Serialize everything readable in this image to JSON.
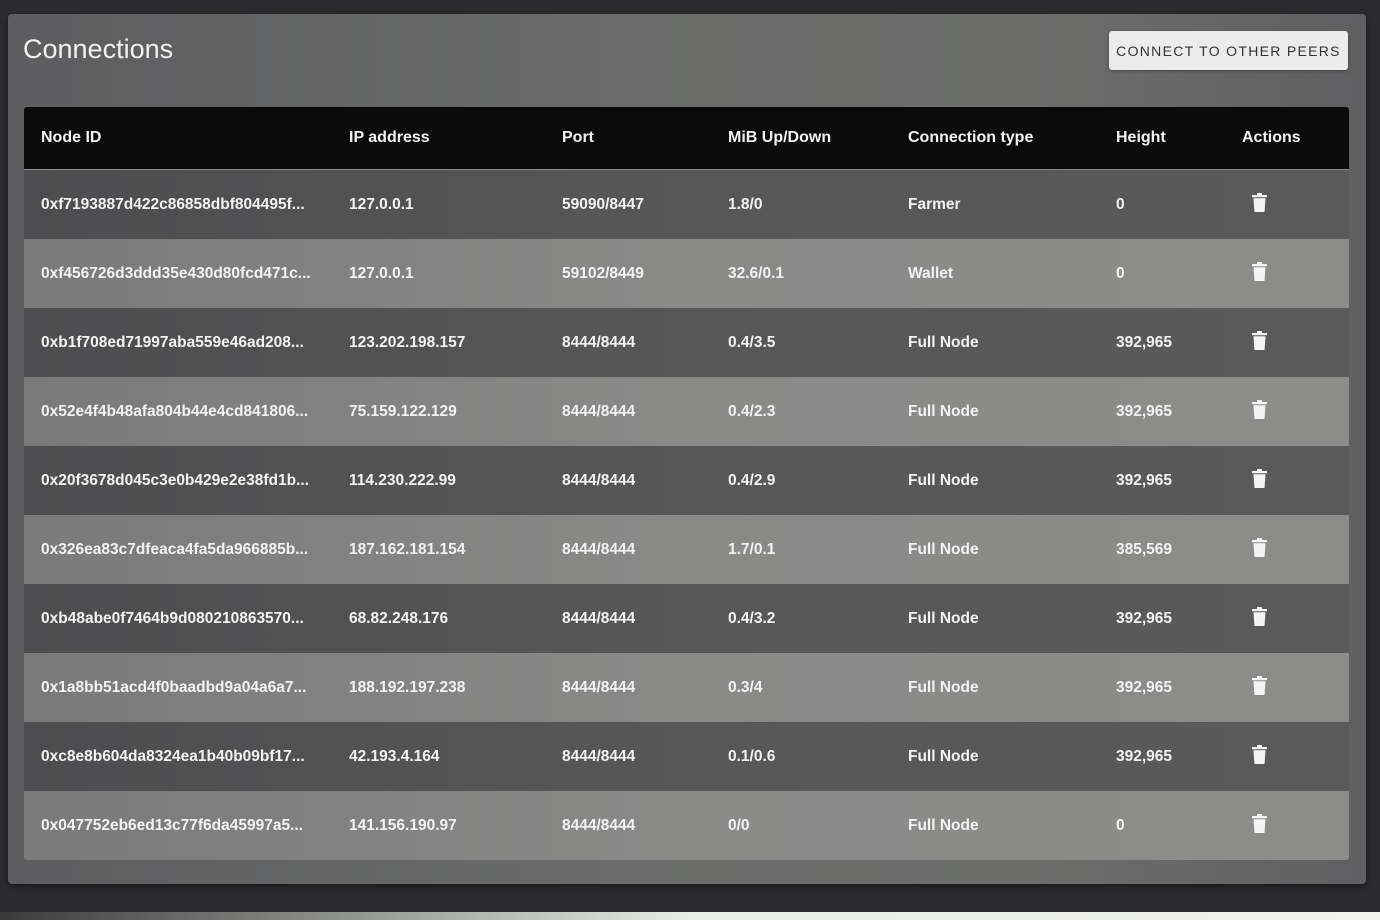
{
  "page": {
    "title": "Connections",
    "connect_button": "CONNECT TO OTHER PEERS"
  },
  "table": {
    "headers": [
      "Node ID",
      "IP address",
      "Port",
      "MiB Up/Down",
      "Connection type",
      "Height",
      "Actions"
    ],
    "rows": [
      {
        "node_id": "0xf7193887d422c86858dbf804495f...",
        "ip": "127.0.0.1",
        "port": "59090/8447",
        "mib": "1.8/0",
        "type": "Farmer",
        "height": "0",
        "action_icon": "trash-icon"
      },
      {
        "node_id": "0xf456726d3ddd35e430d80fcd471c...",
        "ip": "127.0.0.1",
        "port": "59102/8449",
        "mib": "32.6/0.1",
        "type": "Wallet",
        "height": "0",
        "action_icon": "trash-icon"
      },
      {
        "node_id": "0xb1f708ed71997aba559e46ad208...",
        "ip": "123.202.198.157",
        "port": "8444/8444",
        "mib": "0.4/3.5",
        "type": "Full Node",
        "height": "392,965",
        "action_icon": "trash-icon"
      },
      {
        "node_id": "0x52e4f4b48afa804b44e4cd841806...",
        "ip": "75.159.122.129",
        "port": "8444/8444",
        "mib": "0.4/2.3",
        "type": "Full Node",
        "height": "392,965",
        "action_icon": "trash-icon"
      },
      {
        "node_id": "0x20f3678d045c3e0b429e2e38fd1b...",
        "ip": "114.230.222.99",
        "port": "8444/8444",
        "mib": "0.4/2.9",
        "type": "Full Node",
        "height": "392,965",
        "action_icon": "trash-icon"
      },
      {
        "node_id": "0x326ea83c7dfeaca4fa5da966885b...",
        "ip": "187.162.181.154",
        "port": "8444/8444",
        "mib": "1.7/0.1",
        "type": "Full Node",
        "height": "385,569",
        "action_icon": "trash-icon"
      },
      {
        "node_id": "0xb48abe0f7464b9d080210863570...",
        "ip": "68.82.248.176",
        "port": "8444/8444",
        "mib": "0.4/3.2",
        "type": "Full Node",
        "height": "392,965",
        "action_icon": "trash-icon"
      },
      {
        "node_id": "0x1a8bb51acd4f0baadbd9a04a6a7...",
        "ip": "188.192.197.238",
        "port": "8444/8444",
        "mib": "0.3/4",
        "type": "Full Node",
        "height": "392,965",
        "action_icon": "trash-icon"
      },
      {
        "node_id": "0xc8e8b604da8324ea1b40b09bf17...",
        "ip": "42.193.4.164",
        "port": "8444/8444",
        "mib": "0.1/0.6",
        "type": "Full Node",
        "height": "392,965",
        "action_icon": "trash-icon"
      },
      {
        "node_id": "0x047752eb6ed13c77f6da45997a5...",
        "ip": "141.156.190.97",
        "port": "8444/8444",
        "mib": "0/0",
        "type": "Full Node",
        "height": "0",
        "action_icon": "trash-icon"
      }
    ]
  }
}
